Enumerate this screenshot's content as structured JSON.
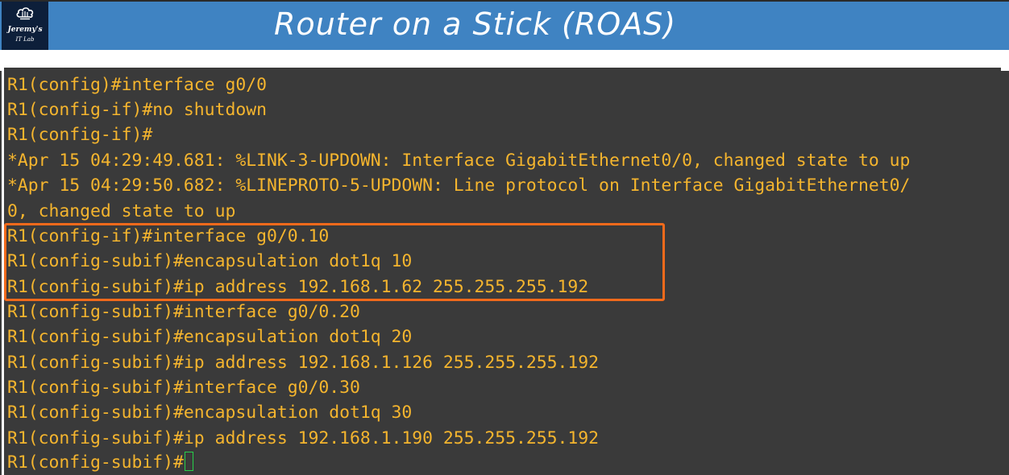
{
  "header": {
    "title": "Router on a Stick (ROAS)",
    "logo": {
      "line1": "Jeremy's",
      "line2": "IT Lab",
      "icon": "cloud-circuit-icon"
    }
  },
  "terminal": {
    "text_color": "#f5b52e",
    "background": "#3a3a3a",
    "highlight_color": "#f26a1b",
    "cursor_color": "#27d04a",
    "lines": [
      "R1(config)#interface g0/0",
      "R1(config-if)#no shutdown",
      "R1(config-if)#",
      "*Apr 15 04:29:49.681: %LINK-3-UPDOWN: Interface GigabitEthernet0/0, changed state to up",
      "*Apr 15 04:29:50.682: %LINEPROTO-5-UPDOWN: Line protocol on Interface GigabitEthernet0/",
      "0, changed state to up",
      "R1(config-if)#interface g0/0.10",
      "R1(config-subif)#encapsulation dot1q 10",
      "R1(config-subif)#ip address 192.168.1.62 255.255.255.192",
      "R1(config-subif)#interface g0/0.20",
      "R1(config-subif)#encapsulation dot1q 20",
      "R1(config-subif)#ip address 192.168.1.126 255.255.255.192",
      "R1(config-subif)#interface g0/0.30",
      "R1(config-subif)#encapsulation dot1q 30",
      "R1(config-subif)#ip address 192.168.1.190 255.255.255.192"
    ],
    "prompt": "R1(config-subif)#"
  }
}
